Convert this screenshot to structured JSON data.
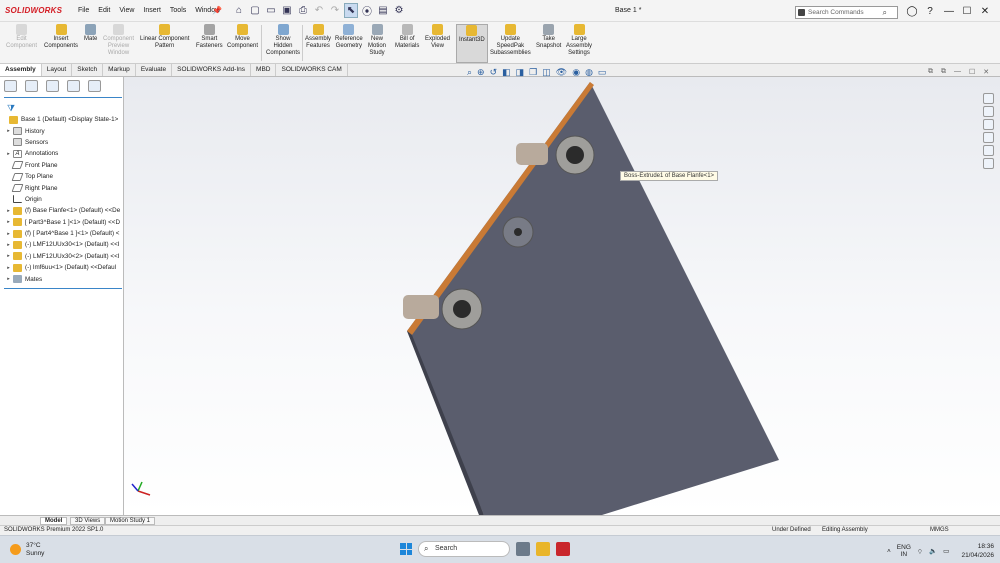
{
  "app": {
    "logo": "SOLIDWORKS",
    "doc_title": "Base 1 *"
  },
  "menu": [
    "File",
    "Edit",
    "View",
    "Insert",
    "Tools",
    "Window"
  ],
  "search": {
    "placeholder": "Search Commands"
  },
  "ribbon": [
    {
      "label": "Edit\nComponent",
      "disabled": true
    },
    {
      "label": "Insert\nComponents"
    },
    {
      "label": "Mate"
    },
    {
      "label": "Component\nPreview\nWindow",
      "disabled": true
    },
    {
      "label": "Linear Component\nPattern"
    },
    {
      "label": "Smart\nFasteners"
    },
    {
      "label": "Move\nComponent"
    },
    {
      "label": "Show\nHidden\nComponents"
    },
    {
      "label": "Assembly\nFeatures"
    },
    {
      "label": "Reference\nGeometry"
    },
    {
      "label": "New\nMotion\nStudy"
    },
    {
      "label": "Bill of\nMaterials"
    },
    {
      "label": "Exploded\nView"
    },
    {
      "label": "Instant3D",
      "active": true
    },
    {
      "label": "Update\nSpeedPak\nSubassemblies"
    },
    {
      "label": "Take\nSnapshot"
    },
    {
      "label": "Large\nAssembly\nSettings"
    }
  ],
  "tabs": [
    "Assembly",
    "Layout",
    "Sketch",
    "Markup",
    "Evaluate",
    "SOLIDWORKS Add-Ins",
    "MBD",
    "SOLIDWORKS CAM"
  ],
  "tree": {
    "root": "Base 1 (Default) <Display State-1>",
    "items": [
      {
        "label": "History",
        "icon": "history"
      },
      {
        "label": "Sensors",
        "icon": "sensor"
      },
      {
        "label": "Annotations",
        "icon": "annotation"
      },
      {
        "label": "Front Plane",
        "icon": "plane"
      },
      {
        "label": "Top Plane",
        "icon": "plane"
      },
      {
        "label": "Right Plane",
        "icon": "plane"
      },
      {
        "label": "Origin",
        "icon": "origin"
      },
      {
        "label": "(f) Base Flanfe<1> (Default) <<De",
        "icon": "part"
      },
      {
        "label": "[ Part3^Base 1 ]<1> (Default) <<D",
        "icon": "part"
      },
      {
        "label": "(f) [ Part4^Base 1 ]<1> (Default) <",
        "icon": "part"
      },
      {
        "label": "(-) LMF12UUx30<1> (Default) <<I",
        "icon": "part"
      },
      {
        "label": "(-) LMF12UUx30<2> (Default) <<I",
        "icon": "part"
      },
      {
        "label": "(-) lmf6uu<1> (Default) <<Defaul",
        "icon": "part"
      },
      {
        "label": "Mates",
        "icon": "mates"
      }
    ]
  },
  "tooltip": "Boss-Extrude1 of Base Flanfe<1>",
  "bottom_tabs": [
    "Model",
    "3D Views",
    "Motion Study 1"
  ],
  "status": {
    "left": "SOLIDWORKS Premium 2022 SP1.0",
    "under_defined": "Under Defined",
    "mode": "Editing Assembly",
    "units": "MMGS"
  },
  "taskbar": {
    "temp": "37°C",
    "condition": "Sunny",
    "search": "Search",
    "lang1": "ENG",
    "lang2": "IN",
    "time": "18:36",
    "date": "21/04/2026"
  }
}
